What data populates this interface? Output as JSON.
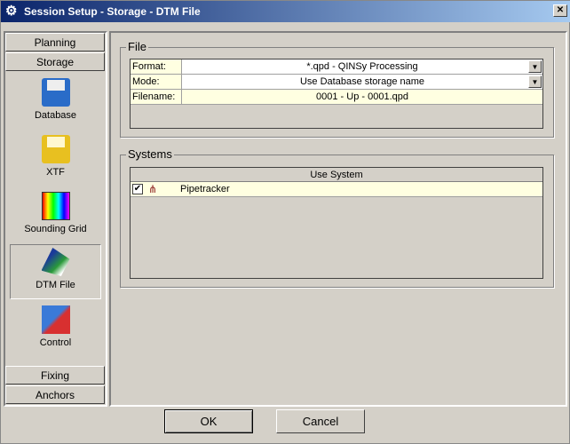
{
  "window": {
    "title": "Session Setup - Storage -  DTM File",
    "close": "✕"
  },
  "nav": {
    "planning": "Planning",
    "storage": "Storage",
    "items": [
      {
        "label": "Database"
      },
      {
        "label": "XTF"
      },
      {
        "label": "Sounding Grid"
      },
      {
        "label": "DTM File"
      },
      {
        "label": "Control"
      }
    ],
    "fixing": "Fixing",
    "anchors": "Anchors"
  },
  "file": {
    "legend": "File",
    "rows": [
      {
        "label": "Format:",
        "value": "*.qpd - QINSy Processing"
      },
      {
        "label": "Mode:",
        "value": "Use Database storage name"
      },
      {
        "label": "Filename:",
        "value": "0001 - Up - 0001.qpd"
      }
    ]
  },
  "systems": {
    "legend": "Systems",
    "header": "Use System",
    "rows": [
      {
        "name": "Pipetracker",
        "checked": true
      }
    ]
  },
  "buttons": {
    "ok": "OK",
    "cancel": "Cancel"
  }
}
